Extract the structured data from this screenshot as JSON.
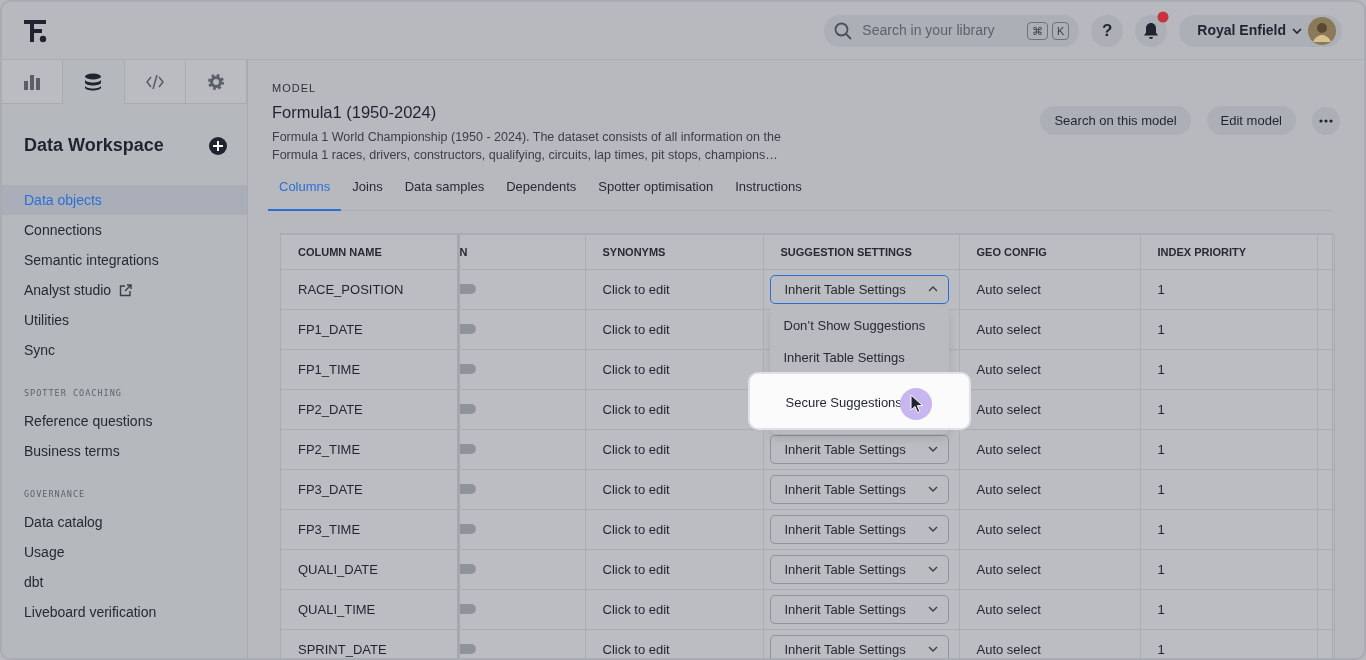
{
  "topbar": {
    "search_placeholder": "Search in your library",
    "shortcut_keys": [
      "⌘",
      "K"
    ],
    "help_label": "?",
    "notification_unread": true,
    "user_name": "Royal Enfield"
  },
  "sidebar": {
    "tabs": [
      {
        "kind": "chart",
        "selected": false
      },
      {
        "kind": "database",
        "selected": true
      },
      {
        "kind": "code",
        "selected": false
      },
      {
        "kind": "settings",
        "selected": false
      }
    ],
    "title": "Data Workspace",
    "items": [
      {
        "label": "Data objects",
        "external": false,
        "selected": true
      },
      {
        "label": "Connections",
        "external": false,
        "selected": false
      },
      {
        "label": "Semantic integrations",
        "external": false,
        "selected": false
      },
      {
        "label": "Analyst studio",
        "external": true,
        "selected": false
      },
      {
        "label": "Utilities",
        "external": false,
        "selected": false
      },
      {
        "label": "Sync",
        "external": false,
        "selected": false
      }
    ],
    "sections": [
      {
        "heading": "SPOTTER COACHING",
        "items": [
          {
            "label": "Reference questions",
            "external": false,
            "selected": false
          },
          {
            "label": "Business terms",
            "external": false,
            "selected": false
          }
        ]
      },
      {
        "heading": "GOVERNANCE",
        "items": [
          {
            "label": "Data catalog",
            "external": false,
            "selected": false
          },
          {
            "label": "Usage",
            "external": false,
            "selected": false
          },
          {
            "label": "dbt",
            "external": false,
            "selected": false
          },
          {
            "label": "Liveboard verification",
            "external": false,
            "selected": false
          }
        ]
      }
    ]
  },
  "model": {
    "label": "MODEL",
    "title": "Formula1 (1950-2024)",
    "description_lines": [
      "Formula 1 World Championship (1950 - 2024). The dataset consists of all information on the",
      "Formula 1 races, drivers, constructors, qualifying, circuits, lap times, pit stops, champions…"
    ],
    "actions": [
      "Search on this model",
      "Edit model"
    ]
  },
  "tabs": [
    {
      "label": "Columns",
      "selected": true
    },
    {
      "label": "Joins",
      "selected": false
    },
    {
      "label": "Data samples",
      "selected": false
    },
    {
      "label": "Dependents",
      "selected": false
    },
    {
      "label": "Spotter optimisation",
      "selected": false
    },
    {
      "label": "Instructions",
      "selected": false
    }
  ],
  "table": {
    "columns": [
      "COLUMN NAME",
      "N",
      "SYNONYMS",
      "SUGGESTION SETTINGS",
      "GEO CONFIG",
      "INDEX PRIORITY"
    ],
    "rows": [
      {
        "name": "RACE_POSITION",
        "toggle_on": false,
        "synonyms": "Click to edit",
        "suggestion": "Inherit Table Settings",
        "open": true,
        "geo": "Auto select",
        "priority": "1"
      },
      {
        "name": "FP1_DATE",
        "toggle_on": false,
        "synonyms": "Click to edit",
        "open": false,
        "geo": "Auto select",
        "priority": "1"
      },
      {
        "name": "FP1_TIME",
        "toggle_on": false,
        "synonyms": "Click to edit",
        "open": false,
        "geo": "Auto select",
        "priority": "1"
      },
      {
        "name": "FP2_DATE",
        "toggle_on": false,
        "synonyms": "Click to edit",
        "open": false,
        "geo": "Auto select",
        "priority": "1"
      },
      {
        "name": "FP2_TIME",
        "toggle_on": false,
        "synonyms": "Click to edit",
        "suggestion": "Inherit Table Settings",
        "open": false,
        "geo": "Auto select",
        "priority": "1"
      },
      {
        "name": "FP3_DATE",
        "toggle_on": false,
        "synonyms": "Click to edit",
        "suggestion": "Inherit Table Settings",
        "open": false,
        "geo": "Auto select",
        "priority": "1"
      },
      {
        "name": "FP3_TIME",
        "toggle_on": false,
        "synonyms": "Click to edit",
        "suggestion": "Inherit Table Settings",
        "open": false,
        "geo": "Auto select",
        "priority": "1"
      },
      {
        "name": "QUALI_DATE",
        "toggle_on": false,
        "synonyms": "Click to edit",
        "suggestion": "Inherit Table Settings",
        "open": false,
        "geo": "Auto select",
        "priority": "1"
      },
      {
        "name": "QUALI_TIME",
        "toggle_on": false,
        "synonyms": "Click to edit",
        "suggestion": "Inherit Table Settings",
        "open": false,
        "geo": "Auto select",
        "priority": "1"
      },
      {
        "name": "SPRINT_DATE",
        "toggle_on": false,
        "synonyms": "Click to edit",
        "suggestion": "Inherit Table Settings",
        "open": false,
        "geo": "Auto select",
        "priority": "1"
      }
    ],
    "dropdown_options": [
      {
        "label": "Don’t Show Suggestions",
        "highlighted": false
      },
      {
        "label": "Inherit Table Settings",
        "highlighted": false
      },
      {
        "label": "Secure Suggestions",
        "highlighted": true
      }
    ]
  }
}
